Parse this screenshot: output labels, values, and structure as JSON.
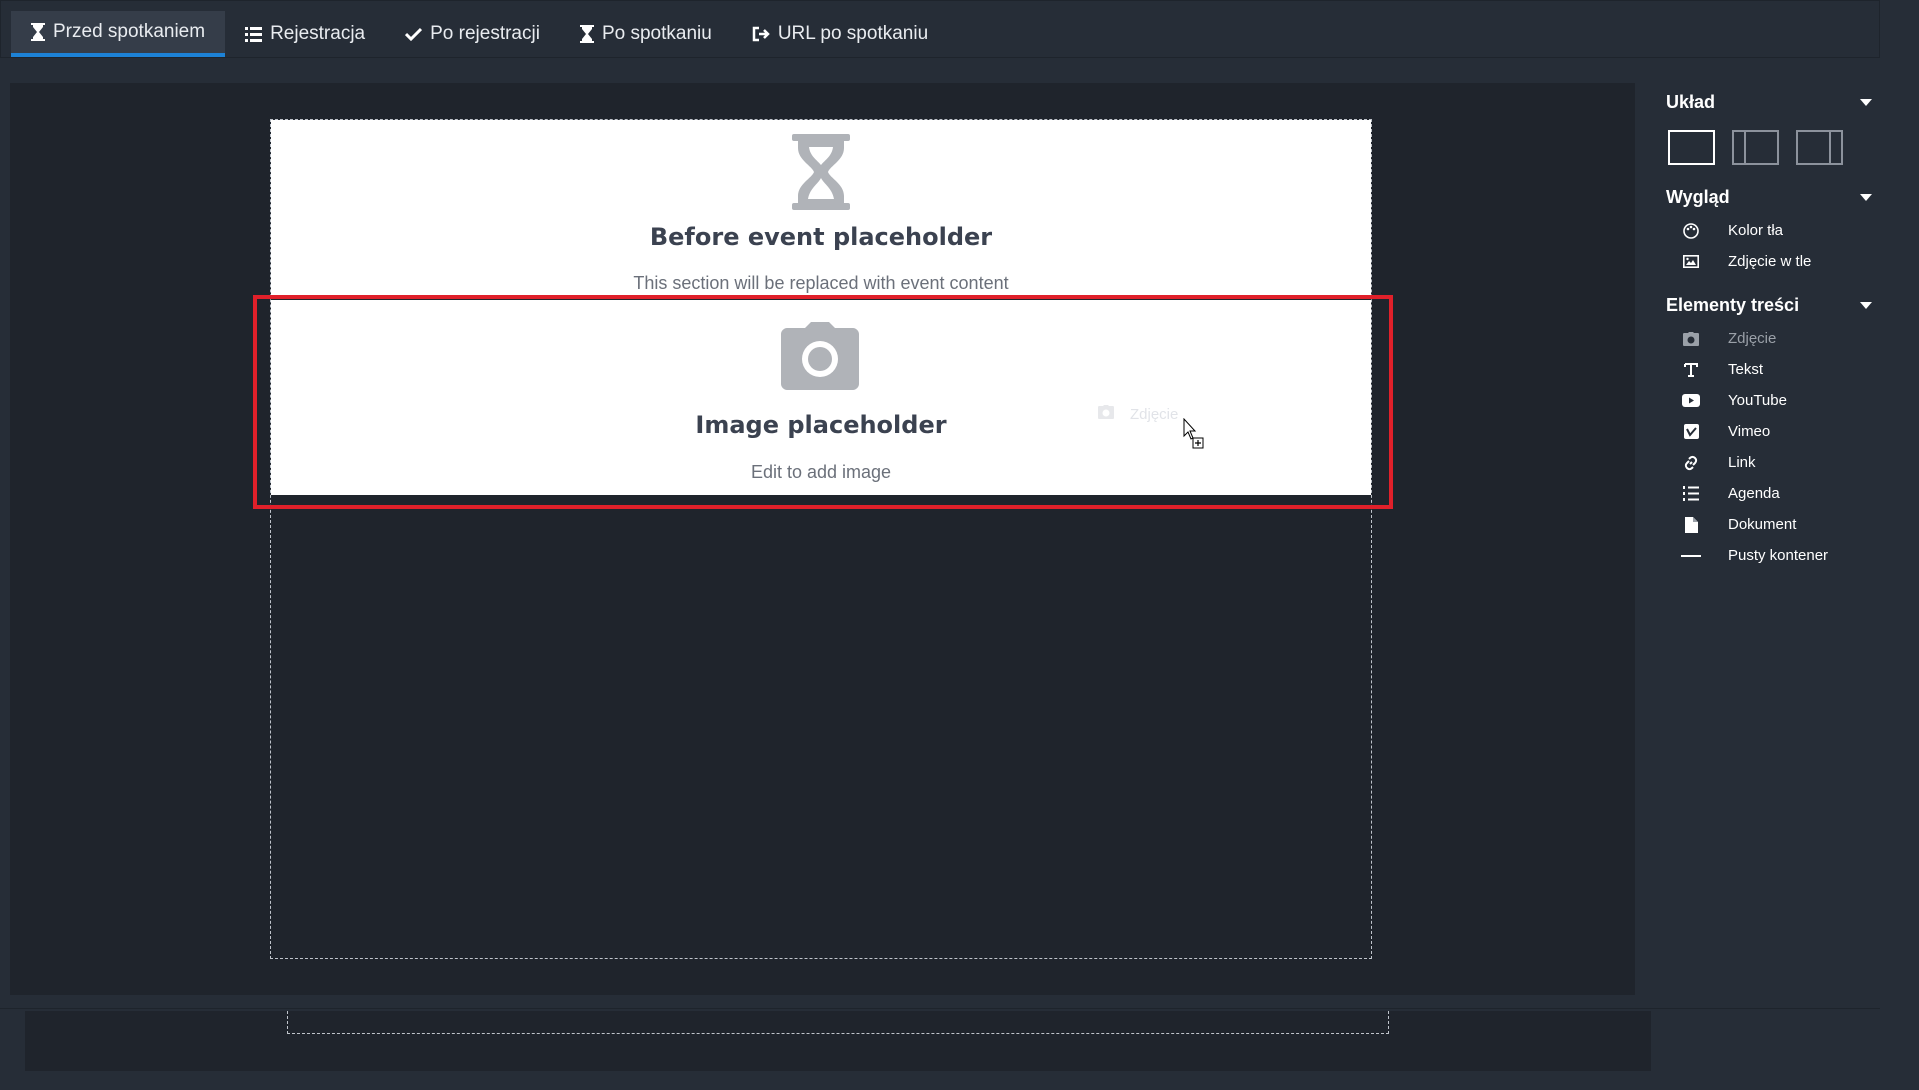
{
  "tabs": [
    {
      "label": "Przed spotkaniem",
      "icon": "hourglass-icon",
      "active": true
    },
    {
      "label": "Rejestracja",
      "icon": "list-icon",
      "active": false
    },
    {
      "label": "Po rejestracji",
      "icon": "check-icon",
      "active": false
    },
    {
      "label": "Po spotkaniu",
      "icon": "hourglass-icon",
      "active": false
    },
    {
      "label": "URL po spotkaniu",
      "icon": "sign-out-icon",
      "active": false
    }
  ],
  "canvas": {
    "before_section": {
      "icon": "hourglass-icon",
      "title": "Before event placeholder",
      "subtitle": "This section will be replaced with event content"
    },
    "image_section": {
      "icon": "camera-icon",
      "title": "Image placeholder",
      "subtitle": "Edit to add image"
    },
    "drag_ghost_label": "Zdjęcie"
  },
  "panel": {
    "layout": {
      "title": "Układ",
      "options": [
        "single-column",
        "left-sidebar",
        "right-sidebar"
      ],
      "selected": "single-column"
    },
    "appearance": {
      "title": "Wygląd",
      "items": [
        {
          "label": "Kolor tła",
          "icon": "palette-icon"
        },
        {
          "label": "Zdjęcie w tle",
          "icon": "image-icon"
        }
      ]
    },
    "content": {
      "title": "Elementy treści",
      "items": [
        {
          "label": "Zdjęcie",
          "icon": "camera-icon",
          "dim": true
        },
        {
          "label": "Tekst",
          "icon": "text-icon"
        },
        {
          "label": "YouTube",
          "icon": "youtube-icon"
        },
        {
          "label": "Vimeo",
          "icon": "vimeo-icon"
        },
        {
          "label": "Link",
          "icon": "link-icon"
        },
        {
          "label": "Agenda",
          "icon": "list-ol-icon"
        },
        {
          "label": "Dokument",
          "icon": "file-icon"
        },
        {
          "label": "Pusty kontener",
          "icon": "minus-icon"
        }
      ]
    }
  },
  "colors": {
    "background": "#262d37",
    "canvas": "#1f242c",
    "active_tab_underline": "#1d82d6",
    "highlight": "#e0202a"
  }
}
